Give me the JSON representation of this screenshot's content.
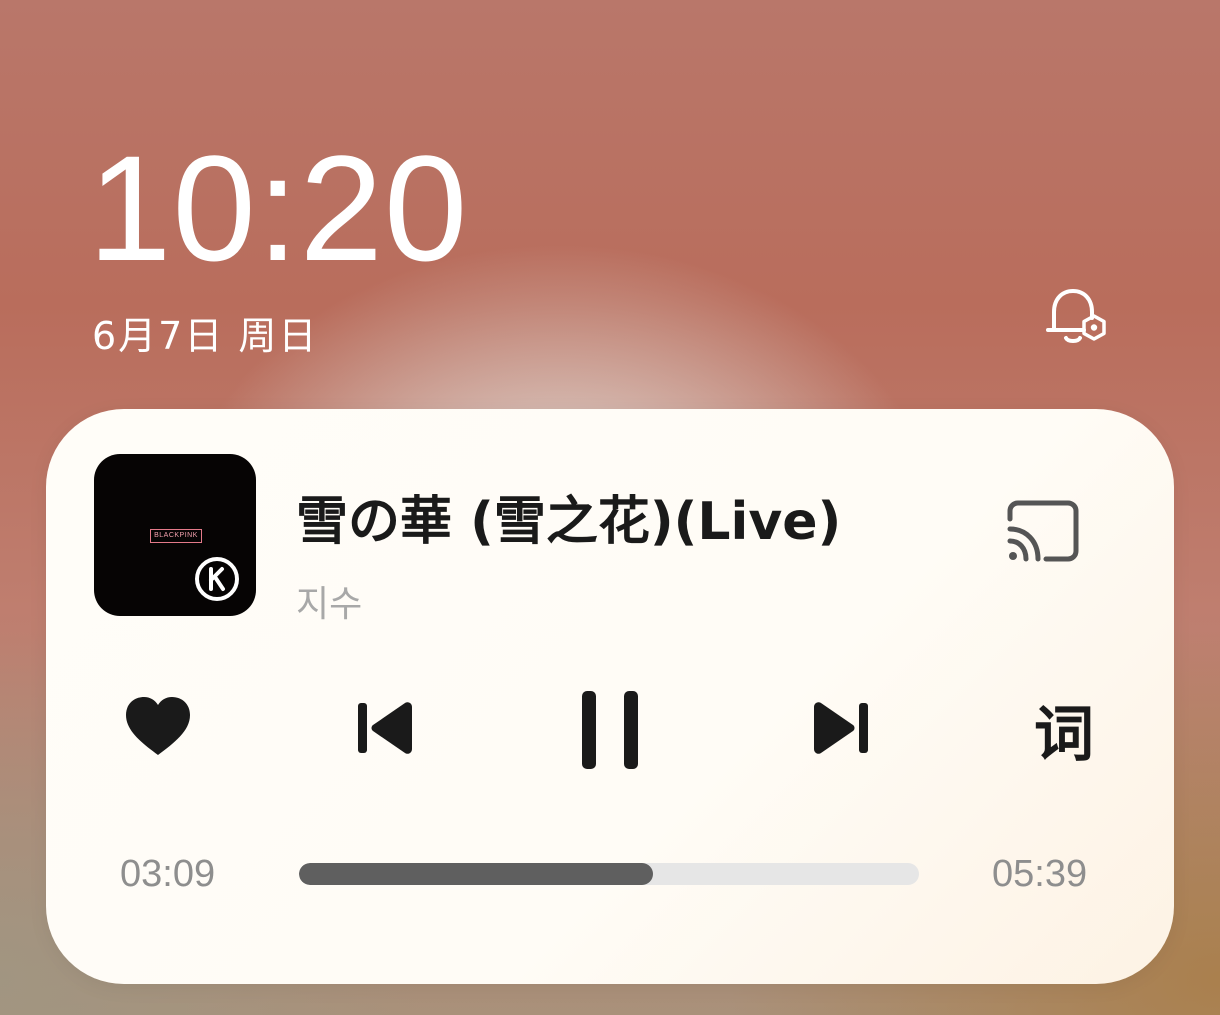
{
  "lockscreen": {
    "time": "10:20",
    "date": "6月7日 周日",
    "bell_icon": "notification-settings-icon"
  },
  "player": {
    "album_cover": {
      "logo_text": "BLACKPINK",
      "sub_text": "",
      "badge_icon": "k-badge-icon"
    },
    "title": "雪の華 (雪之花)(Live)",
    "artist": "지수",
    "cast_icon": "cast-icon",
    "controls": {
      "favorite_icon": "heart-icon",
      "previous_icon": "skip-previous-icon",
      "pause_icon": "pause-icon",
      "next_icon": "skip-next-icon",
      "lyrics_label": "词"
    },
    "progress": {
      "elapsed": "03:09",
      "total": "05:39",
      "fraction": 0.571
    }
  },
  "colors": {
    "text_primary": "#1a1a1a",
    "text_secondary": "#a8a8a8",
    "progress_fill": "#5f5f5f",
    "progress_track": "#e6e6e6",
    "card_bg": "#fffcf6"
  }
}
